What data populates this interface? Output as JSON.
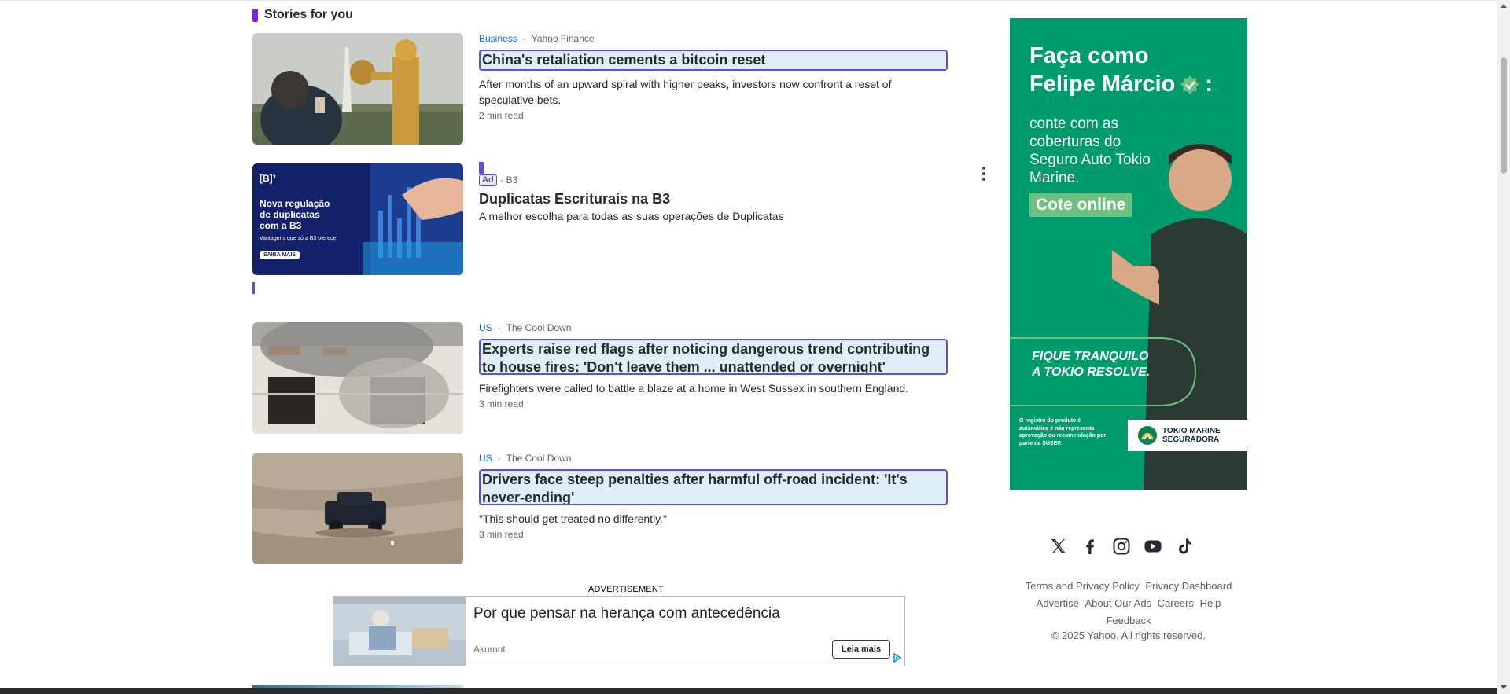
{
  "section": {
    "title": "Stories for you"
  },
  "stories": [
    {
      "category": "Business",
      "source": "Yahoo Finance",
      "headline": "China's retaliation cements a bitcoin reset",
      "summary": "After months of an upward spiral with higher peaks, investors now confront a reset of speculative bets.",
      "readtime": "2 min read"
    },
    {
      "category": "US",
      "source": "The Cool Down",
      "headline": "Experts raise red flags after noticing dangerous trend contributing to house fires: 'Don't leave them ... unattended or overnight'",
      "summary": "Firefighters were called to battle a blaze at a home in West Sussex in southern England.",
      "readtime": "3 min read"
    },
    {
      "category": "US",
      "source": "The Cool Down",
      "headline": "Drivers face steep penalties after harmful off-road incident: 'It's never-ending'",
      "summary": "\"This should get treated no differently.\"",
      "readtime": "3 min read"
    }
  ],
  "sponsored": {
    "tag": "Ad",
    "source": "B3",
    "headline": "Duplicatas Escriturais na B3",
    "description": "A melhor escolha para todas as suas operações de Duplicatas",
    "image_text": {
      "logo": "[B]³",
      "line1": "Nova regulação",
      "line2": "de duplicatas",
      "line3": "com a B3",
      "line4": "Vantagens que só a B3 oferece",
      "button": "SAIBA MAIS"
    }
  },
  "bottom_ad": {
    "label": "ADVERTISEMENT",
    "title": "Por que pensar na herança com antecedência",
    "brand": "Akumut",
    "button": "Leia mais"
  },
  "side_ad": {
    "line1": "Faça como",
    "line2": "Felipe Márcio",
    "line2_suffix": ":",
    "body": "conte com as coberturas do Seguro Auto Tokio Marine.",
    "cta": "Cote online",
    "tag1": "FIQUE TRANQUILO",
    "tag2": "A TOKIO RESOLVE.",
    "disclaimer": "O registro do produto é automático e não representa aprovação ou recomendação por parte da SUSEP.",
    "logo_line1": "TOKIO MARINE",
    "logo_line2": "SEGURADORA",
    "colors": {
      "background": "#009b6d",
      "cta": "#6dc07f"
    }
  },
  "social": [
    "x-icon",
    "facebook-icon",
    "instagram-icon",
    "youtube-icon",
    "tiktok-icon"
  ],
  "footer": {
    "links": [
      "Terms and Privacy Policy",
      "Privacy Dashboard",
      "Advertise",
      "About Our Ads",
      "Careers",
      "Help",
      "Feedback"
    ],
    "copyright": "© 2025 Yahoo. All rights reserved."
  }
}
